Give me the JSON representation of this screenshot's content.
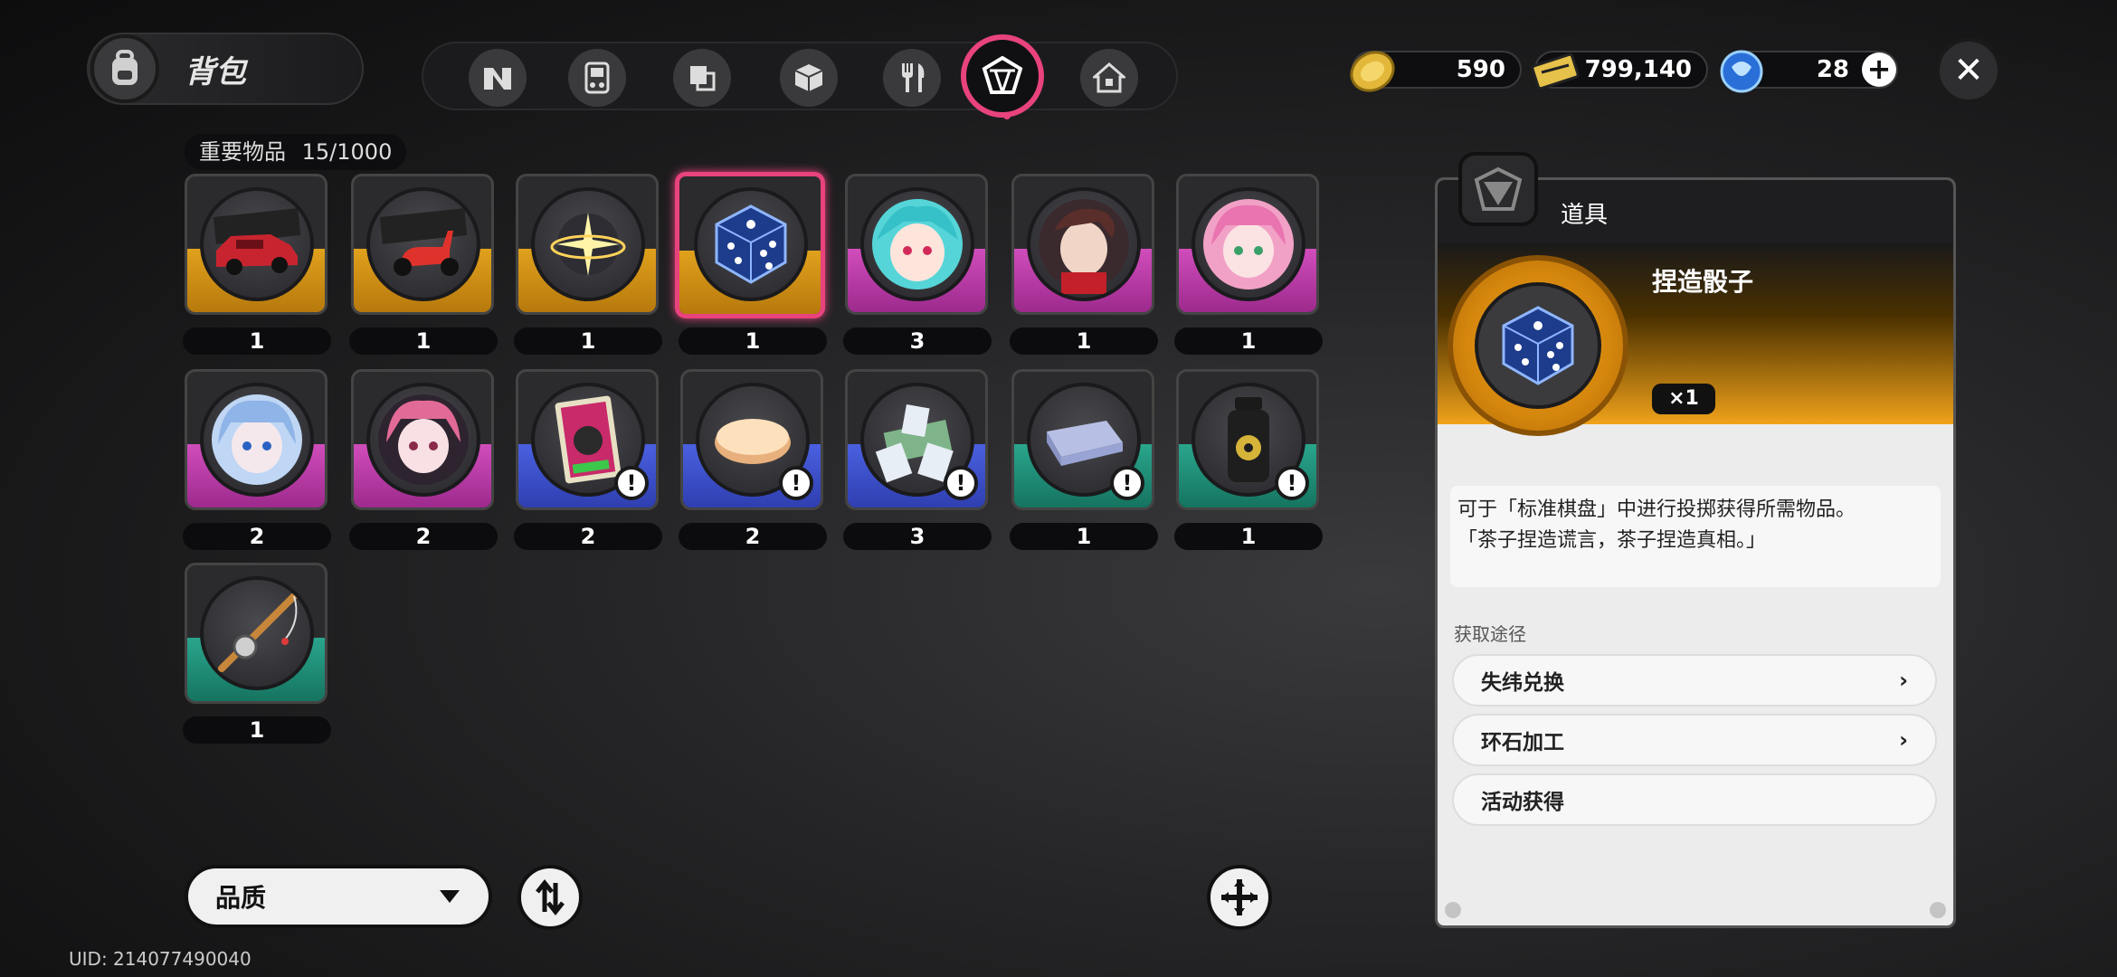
{
  "header": {
    "title": "背包"
  },
  "currency": [
    {
      "name": "coin-icon",
      "value": "590"
    },
    {
      "name": "ticket-icon",
      "value": "799,140"
    },
    {
      "name": "crystal-icon",
      "value": "28"
    }
  ],
  "section": {
    "label": "重要物品",
    "count": "15/1000"
  },
  "items": [
    {
      "name": "red-car",
      "rarity": "gold",
      "count": "1"
    },
    {
      "name": "red-scooter",
      "rarity": "gold",
      "count": "1"
    },
    {
      "name": "light-orb",
      "rarity": "gold",
      "count": "1"
    },
    {
      "name": "blue-dice",
      "rarity": "gold",
      "count": "1",
      "selected": true
    },
    {
      "name": "cyan-hair-character",
      "rarity": "pink",
      "count": "3"
    },
    {
      "name": "brown-hair-character",
      "rarity": "pink",
      "count": "1"
    },
    {
      "name": "pink-hair-character",
      "rarity": "pink",
      "count": "1"
    },
    {
      "name": "blue-hair-character",
      "rarity": "pink",
      "count": "2"
    },
    {
      "name": "red-hair-character",
      "rarity": "pink",
      "count": "2"
    },
    {
      "name": "comic-book",
      "rarity": "blue",
      "count": "2"
    },
    {
      "name": "soap-bar",
      "rarity": "blue",
      "count": "2"
    },
    {
      "name": "cash-cards",
      "rarity": "blue",
      "count": "3"
    },
    {
      "name": "folded-blanket",
      "rarity": "teal",
      "count": "1"
    },
    {
      "name": "biohazard-bottle",
      "rarity": "teal",
      "count": "1"
    },
    {
      "name": "fishing-rod",
      "rarity": "teal",
      "count": "1"
    }
  ],
  "controls": {
    "sort_label": "品质"
  },
  "uid": "UID: 214077490040",
  "detail": {
    "type": "道具",
    "name": "捏造骰子",
    "qty": "×1",
    "desc_line1": "可于「标准棋盘」中进行投掷获得所需物品。",
    "desc_line2": "「茶子捏造谎言，茶子捏造真相。」",
    "source_label": "获取途径",
    "sources": [
      {
        "label": "失纬兑换",
        "has_arrow": true
      },
      {
        "label": "环石加工",
        "has_arrow": true
      },
      {
        "label": "活动获得",
        "has_arrow": false
      }
    ]
  },
  "colors": {
    "accent": "#e8437c",
    "gold": "#e0a11d",
    "pink": "#d04dbb",
    "blue": "#4a60e0",
    "teal": "#2aa58c"
  }
}
